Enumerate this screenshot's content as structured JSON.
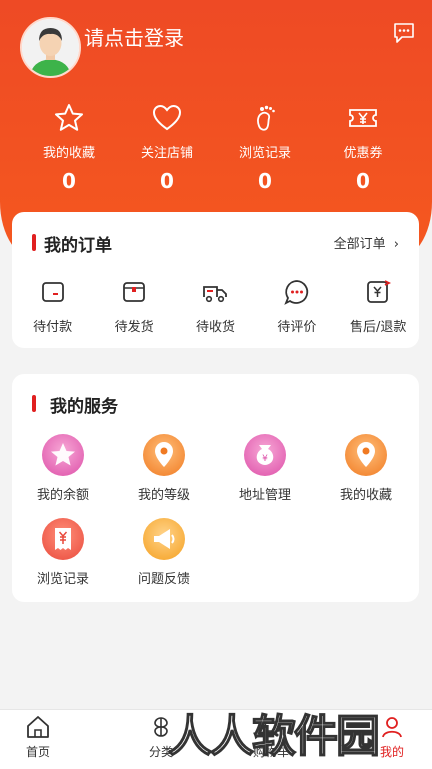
{
  "header": {
    "login_text": "请点击登录",
    "stats": [
      {
        "label": "我的收藏",
        "value": "0",
        "icon": "star-icon"
      },
      {
        "label": "关注店铺",
        "value": "0",
        "icon": "heart-icon"
      },
      {
        "label": "浏览记录",
        "value": "0",
        "icon": "footprint-icon"
      },
      {
        "label": "优惠券",
        "value": "0",
        "icon": "coupon-icon"
      }
    ]
  },
  "orders": {
    "title": "我的订单",
    "all_label": "全部订单",
    "items": [
      {
        "label": "待付款",
        "icon": "wallet-icon"
      },
      {
        "label": "待发货",
        "icon": "package-icon"
      },
      {
        "label": "待收货",
        "icon": "truck-icon"
      },
      {
        "label": "待评价",
        "icon": "comment-icon"
      },
      {
        "label": "售后/退款",
        "icon": "refund-icon"
      }
    ]
  },
  "services": {
    "title": "我的服务",
    "items": [
      {
        "label": "我的余额",
        "icon": "balance-icon"
      },
      {
        "label": "我的等级",
        "icon": "level-icon"
      },
      {
        "label": "地址管理",
        "icon": "address-icon"
      },
      {
        "label": "我的收藏",
        "icon": "favorite-icon"
      },
      {
        "label": "浏览记录",
        "icon": "history-icon"
      },
      {
        "label": "问题反馈",
        "icon": "feedback-icon"
      }
    ]
  },
  "tabbar": {
    "items": [
      {
        "label": "首页",
        "icon": "home-icon"
      },
      {
        "label": "分类",
        "icon": "category-icon"
      },
      {
        "label": "购物车",
        "icon": "cart-icon"
      },
      {
        "label": "我的",
        "icon": "profile-icon"
      }
    ],
    "active_color": "#e02020"
  },
  "watermark": "人人软件园",
  "colors": {
    "accent": "#f5581f",
    "title_bar": "#e02020"
  }
}
